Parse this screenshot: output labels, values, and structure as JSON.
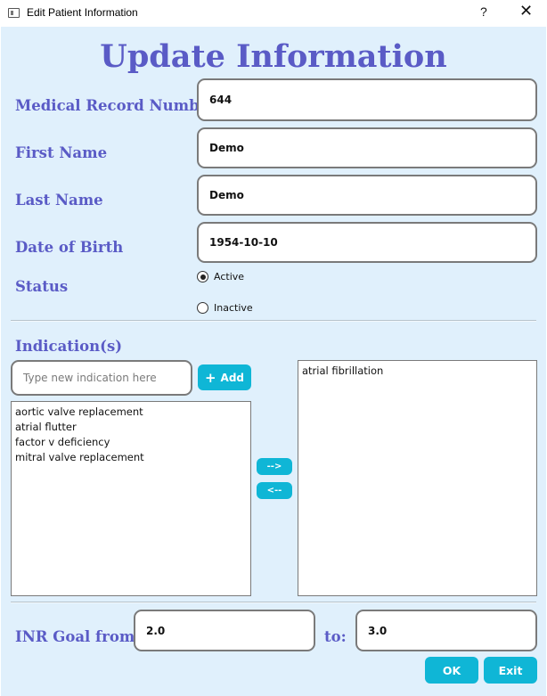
{
  "window": {
    "title": "Edit Patient Information",
    "help_glyph": "?",
    "close_glyph": "✕"
  },
  "heading": "Update Information",
  "form": {
    "mrn_label": "Medical Record Number",
    "mrn_value": "644",
    "first_name_label": "First Name",
    "first_name_value": "Demo",
    "last_name_label": "Last Name",
    "last_name_value": "Demo",
    "dob_label": "Date of Birth",
    "dob_value": "1954-10-10",
    "status_label": "Status",
    "status_options": [
      {
        "label": "Active",
        "selected": true
      },
      {
        "label": "Inactive",
        "selected": false
      }
    ]
  },
  "indications": {
    "label": "Indication(s)",
    "input_placeholder": "Type new indication here",
    "add_button": "Add",
    "add_icon": "plus-icon",
    "available": [
      "aortic valve replacement",
      "atrial flutter",
      "factor v deficiency",
      "mitral valve replacement"
    ],
    "selected": [
      "atrial fibrillation"
    ],
    "move_right_button": "-->",
    "move_left_button": "<--"
  },
  "inr": {
    "from_label": "INR Goal from:",
    "from_value": "2.0",
    "to_label": "to:",
    "to_value": "3.0"
  },
  "actions": {
    "ok": "OK",
    "exit": "Exit"
  },
  "colors": {
    "label": "#5a5bc6",
    "background": "#e0f0fc",
    "button": "#0fb6d6"
  }
}
